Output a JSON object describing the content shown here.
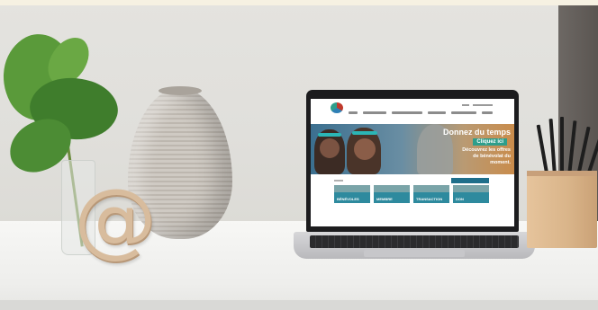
{
  "scene": {
    "objects": [
      "plant-in-glass-vase",
      "ceramic-vase",
      "wooden-at-sign",
      "laptop",
      "pencil-holder"
    ]
  },
  "decor": {
    "at_symbol": "@"
  },
  "colors": {
    "wall": "#e2e1dd",
    "desk": "#f3f3f1",
    "leaf": "#4f8a36",
    "site_teal": "#2e9e8b",
    "site_blue": "#1f6f8b"
  },
  "website": {
    "hero": {
      "title": "Donnez du temps",
      "button": "Cliquez ici",
      "subtitle": "Découvrez les offres de bénévolat du moment."
    },
    "cards": [
      {
        "label": "BÉNÉVOLES"
      },
      {
        "label": "MEMBRE"
      },
      {
        "label": "TRANSACTION"
      },
      {
        "label": "DON"
      }
    ]
  }
}
